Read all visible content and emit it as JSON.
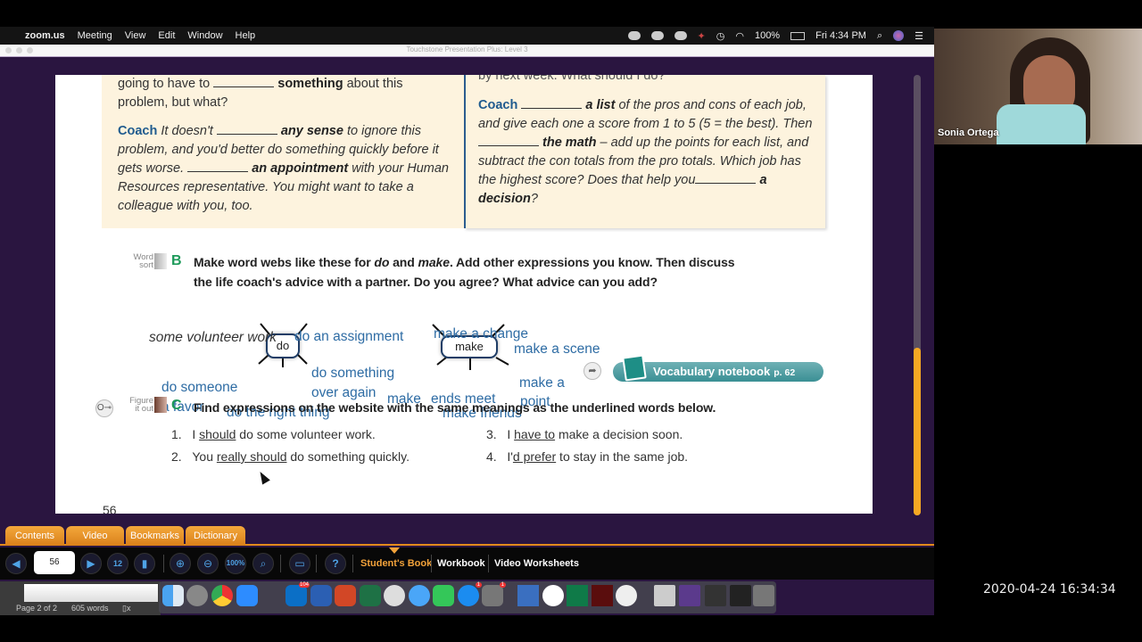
{
  "menubar": {
    "app": "zoom.us",
    "items": [
      "Meeting",
      "View",
      "Edit",
      "Window",
      "Help"
    ],
    "battery": "100%",
    "clock": "Fri 4:34 PM"
  },
  "window": {
    "title": "Touchstone Presentation Plus: Level 3"
  },
  "dialogue": {
    "left_top_line1_pre": "going to have to",
    "left_top_line1_bold": "something",
    "left_top_line1_post": "about this",
    "left_top_line2": "problem, but what?",
    "coach_label": "Coach",
    "left_coach_1": "It doesn't",
    "left_coach_bold1": "any sense",
    "left_coach_2": "to ignore this problem, and you'd better do something quickly before it gets worse.",
    "left_coach_bold2": "an appointment",
    "left_coach_3": "with your Human Resources representative. You might want to take a colleague with you, too.",
    "right_top_cut": "by next week. What should I do?",
    "right_coach_bold1": "a list",
    "right_coach_1": "of the pros and cons of each job, and give each one a score from 1 to 5 (5 = the best). Then",
    "right_coach_bold2": "the math",
    "right_coach_2": "– add up the points for each list, and subtract the con totals from the pro totals. Which job has the highest score? Does that help you",
    "right_coach_bold3": "a decision",
    "right_coach_end": "?"
  },
  "exercise_b": {
    "tag_line1": "Word",
    "tag_line2": "sort",
    "letter": "B",
    "line1_a": "Make word webs like these for",
    "do_word": "do",
    "and_word": "and",
    "make_word": "make",
    "line1_b": ". Add other expressions you know. Then discuss",
    "line2": "the life coach's advice with a partner. Do you agree? What advice can you add?"
  },
  "word_webs": {
    "do_node": "do",
    "make_node": "make",
    "do_expressions": [
      "some volunteer work",
      "do an assignment",
      "do something",
      "over again",
      "do someone",
      "a favor",
      "do the right thing"
    ],
    "make_expressions": [
      "make a change",
      "make a scene",
      "make a",
      "point",
      "make",
      "ends meet",
      "make friends"
    ]
  },
  "vocab_button": {
    "label": "Vocabulary notebook",
    "page": "p. 62"
  },
  "exercise_c": {
    "tag_line1": "Figure",
    "tag_line2": "it out",
    "letter": "C",
    "instruction": "Find expressions on the website with the same meanings as the underlined words below.",
    "items": [
      {
        "num": "1.",
        "pre": "I ",
        "underlined": "should",
        "post": " do some volunteer work."
      },
      {
        "num": "2.",
        "pre": "You ",
        "underlined": "really should",
        "post": " do something quickly."
      },
      {
        "num": "3.",
        "pre": "I ",
        "underlined": "have to",
        "post": " make a decision soon."
      },
      {
        "num": "4.",
        "pre": "I'",
        "underlined": "d prefer",
        "post": " to stay in the same job."
      }
    ]
  },
  "page_number": "56",
  "scroll_position": 0.38,
  "tabs": [
    "Contents",
    "Video",
    "Bookmarks",
    "Dictionary"
  ],
  "toolbar": {
    "page_value": "56",
    "zoom_label": "100%",
    "books": [
      "Student's Book",
      "Workbook",
      "Video Worksheets"
    ],
    "active_book": "Student's Book"
  },
  "statusbar": {
    "page": "Page 2 of 2",
    "words": "605 words"
  },
  "dock": {
    "outlook_badge": "104",
    "appstore_badge": "1",
    "settings_badge": "1"
  },
  "participant": {
    "name": "Sonia Ortega"
  },
  "timestamp": "2020-04-24  16:34:34"
}
